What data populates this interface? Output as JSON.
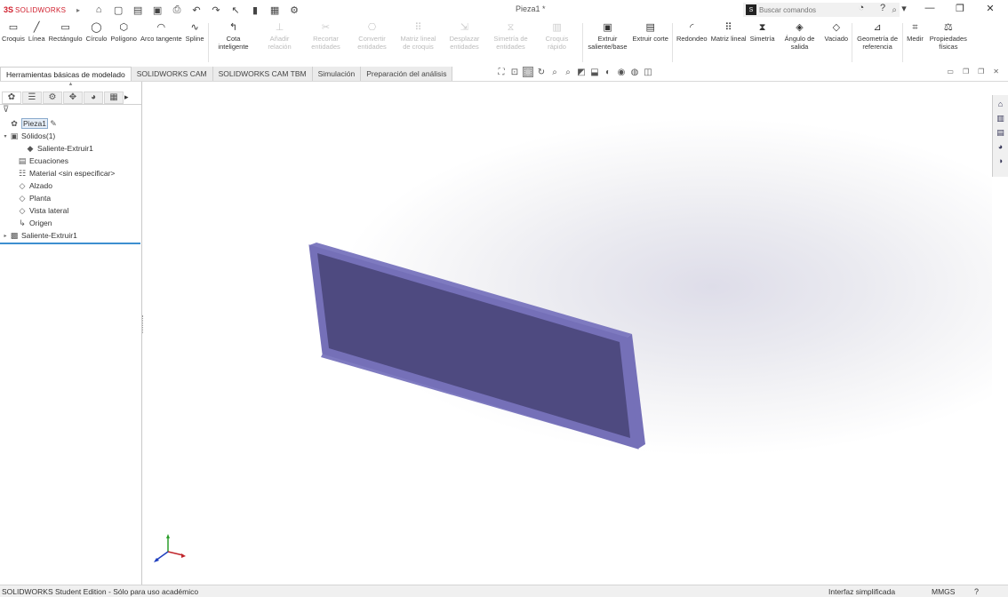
{
  "app": {
    "logo_ds": "3S",
    "logo_text": "SOLIDWORKS",
    "doc_title": "Pieza1 *",
    "search_placeholder": "Buscar comandos",
    "search_badge": "S"
  },
  "quick_access": [
    {
      "name": "home-icon",
      "glyph": "⌂"
    },
    {
      "name": "new-document-icon",
      "glyph": "▢"
    },
    {
      "name": "open-icon",
      "glyph": "▤"
    },
    {
      "name": "save-icon",
      "glyph": "▣"
    },
    {
      "name": "print-icon",
      "glyph": "⎙"
    },
    {
      "name": "undo-icon",
      "glyph": "↶"
    },
    {
      "name": "redo-icon",
      "glyph": "↷"
    },
    {
      "name": "select-icon",
      "glyph": "↖"
    },
    {
      "name": "rebuild-icon",
      "glyph": "▮"
    },
    {
      "name": "file-properties-icon",
      "glyph": "▦"
    },
    {
      "name": "options-icon",
      "glyph": "⚙"
    }
  ],
  "title_right": {
    "glyphs": [
      "◔",
      "?",
      "▾"
    ],
    "window_buttons": [
      "—",
      "❐",
      "✕"
    ]
  },
  "ribbon": [
    {
      "label": "Croquis",
      "glyph": "▭",
      "enabled": true
    },
    {
      "label": "Línea",
      "glyph": "╱",
      "enabled": true
    },
    {
      "label": "Rectángulo",
      "glyph": "▭",
      "enabled": true
    },
    {
      "label": "Círculo",
      "glyph": "◯",
      "enabled": true
    },
    {
      "label": "Polígono",
      "glyph": "⬡",
      "enabled": true
    },
    {
      "label": "Arco tangente",
      "glyph": "◠",
      "enabled": true
    },
    {
      "label": "Spline",
      "glyph": "∿",
      "enabled": true
    },
    {
      "label": "Cota inteligente",
      "glyph": "↰",
      "enabled": true
    },
    {
      "label": "Añadir relación",
      "glyph": "⊥",
      "enabled": false
    },
    {
      "label": "Recortar entidades",
      "glyph": "✂",
      "enabled": false
    },
    {
      "label": "Convertir entidades",
      "glyph": "⎔",
      "enabled": false
    },
    {
      "label": "Matriz lineal de croquis",
      "glyph": "⠿",
      "enabled": false
    },
    {
      "label": "Desplazar entidades",
      "glyph": "⇲",
      "enabled": false
    },
    {
      "label": "Simetría de entidades",
      "glyph": "⧖",
      "enabled": false
    },
    {
      "label": "Croquis rápido",
      "glyph": "▥",
      "enabled": false
    },
    {
      "label": "Extruir saliente/base",
      "glyph": "▣",
      "enabled": true
    },
    {
      "label": "Extruir corte",
      "glyph": "▤",
      "enabled": true
    },
    {
      "label": "Redondeo",
      "glyph": "◜",
      "enabled": true
    },
    {
      "label": "Matriz lineal",
      "glyph": "⠿",
      "enabled": true
    },
    {
      "label": "Simetría",
      "glyph": "⧗",
      "enabled": true
    },
    {
      "label": "Ángulo de salida",
      "glyph": "◈",
      "enabled": true
    },
    {
      "label": "Vaciado",
      "glyph": "◇",
      "enabled": true
    },
    {
      "label": "Geometría de referencia",
      "glyph": "⊿",
      "enabled": true
    },
    {
      "label": "Medir",
      "glyph": "⌗",
      "enabled": true
    },
    {
      "label": "Propiedades físicas",
      "glyph": "⚖",
      "enabled": true
    }
  ],
  "tabs": [
    {
      "label": "Herramientas básicas de modelado",
      "active": true
    },
    {
      "label": "SOLIDWORKS CAM",
      "active": false
    },
    {
      "label": "SOLIDWORKS CAM TBM",
      "active": false
    },
    {
      "label": "Simulación",
      "active": false
    },
    {
      "label": "Preparación del análisis",
      "active": false
    }
  ],
  "view_tools": [
    {
      "name": "zoom-to-fit-icon",
      "glyph": "⛶",
      "selected": false
    },
    {
      "name": "zoom-area-icon",
      "glyph": "⊡",
      "selected": false
    },
    {
      "name": "select-tool-icon",
      "glyph": "⬚",
      "selected": true
    },
    {
      "name": "rotate-icon",
      "glyph": "↻",
      "selected": false
    },
    {
      "name": "zoom-icon",
      "glyph": "⌕",
      "selected": false
    },
    {
      "name": "pan-icon",
      "glyph": "⌕",
      "selected": false
    },
    {
      "name": "section-view-icon",
      "glyph": "◩",
      "selected": false
    },
    {
      "name": "view-orientation-icon",
      "glyph": "⬓",
      "selected": false
    },
    {
      "name": "display-style-icon",
      "glyph": "◐",
      "selected": false
    },
    {
      "name": "hide-show-icon",
      "glyph": "◉",
      "selected": false
    },
    {
      "name": "appearance-icon",
      "glyph": "◍",
      "selected": false
    },
    {
      "name": "scene-icon",
      "glyph": "◫",
      "selected": false
    }
  ],
  "window_controls": [
    "▭",
    "❐",
    "❐",
    "✕"
  ],
  "fm_tabs": [
    {
      "name": "feature-manager-tab",
      "glyph": "✿",
      "active": true
    },
    {
      "name": "property-manager-tab",
      "glyph": "☰",
      "active": false
    },
    {
      "name": "configuration-manager-tab",
      "glyph": "⚙",
      "active": false
    },
    {
      "name": "dimxpert-tab",
      "glyph": "✥",
      "active": false
    },
    {
      "name": "display-manager-tab",
      "glyph": "◕",
      "active": false
    },
    {
      "name": "cam-tab",
      "glyph": "▦",
      "active": false
    }
  ],
  "fm_more": "▸",
  "fm_filter_glyph": "⊽",
  "tree": [
    {
      "label": "Pieza1",
      "glyph": "✿",
      "indent": 0,
      "arrow": "",
      "selected": true,
      "extra": "✎"
    },
    {
      "label": "Sólidos(1)",
      "glyph": "▣",
      "indent": 0,
      "arrow": "▾",
      "selected": false
    },
    {
      "label": "Saliente-Extruir1",
      "glyph": "◆",
      "indent": 2,
      "arrow": "",
      "selected": false
    },
    {
      "label": "Ecuaciones",
      "glyph": "▤",
      "indent": 1,
      "arrow": "",
      "selected": false
    },
    {
      "label": "Material <sin especificar>",
      "glyph": "☷",
      "indent": 1,
      "arrow": "",
      "selected": false
    },
    {
      "label": "Alzado",
      "glyph": "◇",
      "indent": 1,
      "arrow": "",
      "selected": false
    },
    {
      "label": "Planta",
      "glyph": "◇",
      "indent": 1,
      "arrow": "",
      "selected": false
    },
    {
      "label": "Vista lateral",
      "glyph": "◇",
      "indent": 1,
      "arrow": "",
      "selected": false
    },
    {
      "label": "Origen",
      "glyph": "↳",
      "indent": 1,
      "arrow": "",
      "selected": false
    },
    {
      "label": "Saliente-Extruir1",
      "glyph": "▩",
      "indent": 0,
      "arrow": "▸",
      "selected": false
    }
  ],
  "taskpane": [
    {
      "name": "resources-icon",
      "glyph": "⌂"
    },
    {
      "name": "design-library-icon",
      "glyph": "▥"
    },
    {
      "name": "file-explorer-icon",
      "glyph": "▤"
    },
    {
      "name": "view-palette-icon",
      "glyph": "◕"
    },
    {
      "name": "appearances-icon",
      "glyph": "◑"
    }
  ],
  "colors": {
    "model_face": "#4e4a80",
    "model_edge": "#7570b8",
    "model_rim": "#7e7ac0"
  },
  "status": {
    "edition": "SOLIDWORKS Student Edition - Sólo para uso académico",
    "mode": "Interfaz simplificada",
    "units": "MMGS",
    "help": "?"
  }
}
